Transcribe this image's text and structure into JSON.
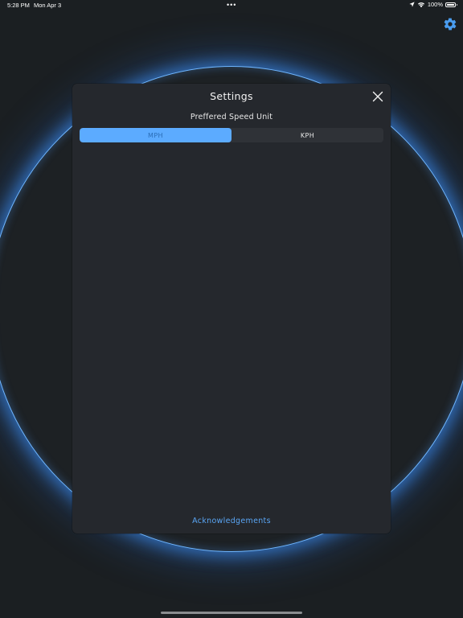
{
  "status_bar": {
    "time": "5:28 PM",
    "date": "Mon Apr 3",
    "dots": "•••",
    "battery": "100%",
    "battery_level": 1.0
  },
  "modal": {
    "title": "Settings",
    "speed_unit_label": "Preffered Speed Unit",
    "segments": [
      "MPH",
      "KPH"
    ],
    "selected_segment": "MPH",
    "acknowledgements": "Acknowledgements"
  },
  "colors": {
    "accent": "#5cabff",
    "ring_glow": "#4096ff",
    "background": "#1b1f22",
    "modal": "#25282d"
  },
  "icons": {
    "settings": "gear-icon",
    "close": "close-icon",
    "location": "location-arrow-icon",
    "wifi": "wifi-icon",
    "battery": "battery-icon"
  }
}
